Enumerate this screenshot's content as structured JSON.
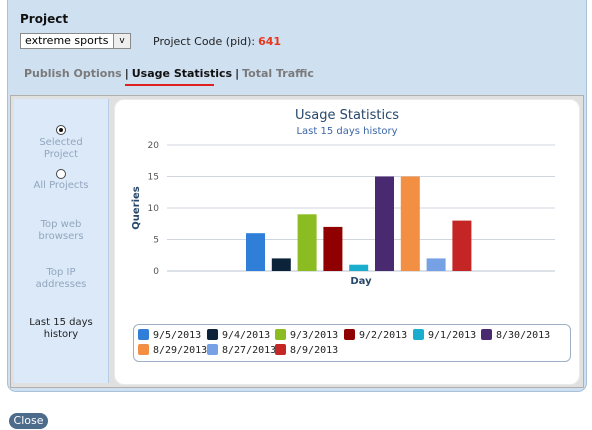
{
  "project": {
    "label": "Project",
    "selected": "extreme sports",
    "dropdown_arrow": "v",
    "pid_label": "Project Code (pid):",
    "pid_value": "641"
  },
  "tabs": [
    {
      "label": "Publish Options",
      "active": false
    },
    {
      "label": "Usage Statistics",
      "active": true
    },
    {
      "label": "Total Traffic",
      "active": false
    }
  ],
  "tab_separator": "|",
  "sidebar": {
    "selected_project_label": [
      "Selected",
      "Project"
    ],
    "all_projects_label": "All Projects",
    "top_browsers_label": [
      "Top web",
      "browsers"
    ],
    "top_ip_label": [
      "Top IP",
      "addresses"
    ],
    "history_label": [
      "Last 15 days",
      "history"
    ]
  },
  "close_label": "Close",
  "chart_data": {
    "type": "bar",
    "title": "Usage Statistics",
    "subtitle": "Last 15 days history",
    "xlabel": "Day",
    "ylabel": "Queries",
    "ylim": [
      0,
      20
    ],
    "yticks": [
      0,
      5,
      10,
      15,
      20
    ],
    "grid": true,
    "legend_position": "bottom",
    "series": [
      {
        "name": "9/5/2013",
        "values": [
          6
        ],
        "color": "#2f7ed8"
      },
      {
        "name": "9/4/2013",
        "values": [
          2
        ],
        "color": "#0d233a"
      },
      {
        "name": "9/3/2013",
        "values": [
          9
        ],
        "color": "#8bbc21"
      },
      {
        "name": "9/2/2013",
        "values": [
          7
        ],
        "color": "#910000"
      },
      {
        "name": "9/1/2013",
        "values": [
          1
        ],
        "color": "#1aadce"
      },
      {
        "name": "8/30/2013",
        "values": [
          15
        ],
        "color": "#492970"
      },
      {
        "name": "8/29/2013",
        "values": [
          15
        ],
        "color": "#f28f43"
      },
      {
        "name": "8/27/2013",
        "values": [
          2
        ],
        "color": "#77a1e5"
      },
      {
        "name": "8/9/2013",
        "values": [
          8
        ],
        "color": "#c42525"
      }
    ]
  }
}
